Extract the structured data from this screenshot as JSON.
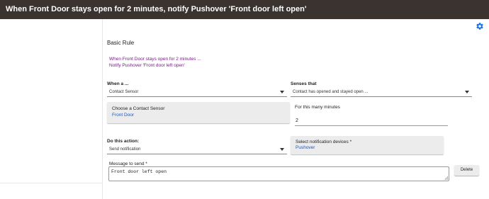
{
  "window": {
    "title": "When Front Door stays open for 2 minutes, notify Pushover 'Front door left open'"
  },
  "header": {
    "title": "Basic Rule",
    "settings_icon": "gear-icon"
  },
  "summary": {
    "line1": "When Front Door stays open for 2 minutes ...",
    "line2": "Notify Pushover 'Front door left open'"
  },
  "trigger": {
    "when_label": "When a ...",
    "when_value": "Contact Sensor",
    "senses_label": "Senses that",
    "senses_value": "Contact has opened and stayed open ...",
    "device_card_title": "Choose a Contact Sensor",
    "device_card_value": "Front Door",
    "minutes_label": "For this many minutes",
    "minutes_value": "2"
  },
  "action": {
    "do_label": "Do this action:",
    "do_value": "Send notification",
    "notify_card_title": "Select notification devices *",
    "notify_card_value": "Pushover",
    "message_label": "Message to send *",
    "message_value": "Front door left open",
    "delete_label": "Delete"
  },
  "colors": {
    "titlebar": "#3b3330",
    "summary_text": "#7a1a8a",
    "link_blue": "#1a56c4",
    "gear_blue": "#1a73e8"
  }
}
